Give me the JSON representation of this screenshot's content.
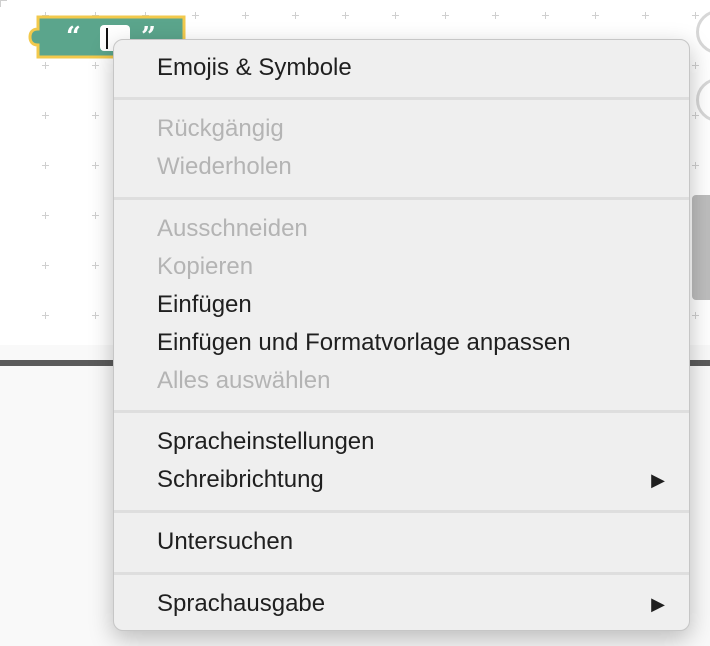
{
  "workspace": {
    "text_block": {
      "open_quote": "“",
      "close_quote": "”",
      "value": "",
      "color": "#5ba58c",
      "outline_color": "#f2c94c"
    }
  },
  "context_menu": {
    "groups": [
      {
        "items": [
          {
            "label": "Emojis & Symbole",
            "enabled": true
          }
        ]
      },
      {
        "items": [
          {
            "label": "Rückgängig",
            "enabled": false
          },
          {
            "label": "Wiederholen",
            "enabled": false
          }
        ]
      },
      {
        "items": [
          {
            "label": "Ausschneiden",
            "enabled": false
          },
          {
            "label": "Kopieren",
            "enabled": false
          },
          {
            "label": "Einfügen",
            "enabled": true
          },
          {
            "label": "Einfügen und Formatvorlage anpassen",
            "enabled": true
          },
          {
            "label": "Alles auswählen",
            "enabled": false
          }
        ]
      },
      {
        "items": [
          {
            "label": "Spracheinstellungen",
            "enabled": true
          },
          {
            "label": "Schreibrichtung",
            "enabled": true,
            "submenu_arrow": "▶"
          }
        ]
      },
      {
        "items": [
          {
            "label": "Untersuchen",
            "enabled": true
          }
        ]
      },
      {
        "items": [
          {
            "label": "Sprachausgabe",
            "enabled": true,
            "submenu_arrow": "▶"
          }
        ]
      }
    ]
  },
  "colors": {
    "menu_background": "#efefef",
    "enabled_text": "#1f1f1f",
    "disabled_text": "#b4b4b4",
    "separator": "#dedede"
  }
}
